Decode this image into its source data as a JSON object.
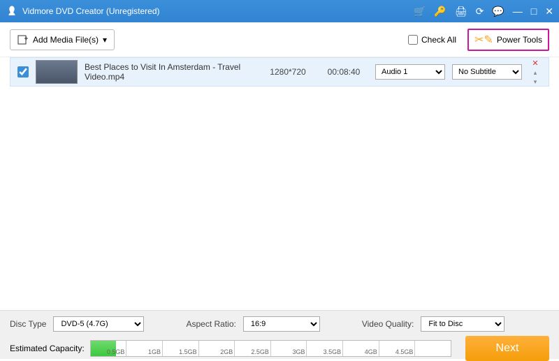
{
  "titlebar": {
    "title": "Vidmore DVD Creator (Unregistered)"
  },
  "toolbar": {
    "add_media": "Add Media File(s)",
    "check_all": "Check All",
    "power_tools": "Power Tools"
  },
  "media": {
    "items": [
      {
        "checked": true,
        "filename": "Best Places to Visit In Amsterdam - Travel Video.mp4",
        "resolution": "1280*720",
        "duration": "00:08:40",
        "audio": "Audio 1",
        "subtitle": "No Subtitle"
      }
    ]
  },
  "bottom": {
    "disc_type_label": "Disc Type",
    "disc_type": "DVD-5 (4.7G)",
    "aspect_label": "Aspect Ratio:",
    "aspect": "16:9",
    "quality_label": "Video Quality:",
    "quality": "Fit to Disc",
    "capacity_label": "Estimated Capacity:",
    "ticks": [
      "0.5GB",
      "1GB",
      "1.5GB",
      "2GB",
      "2.5GB",
      "3GB",
      "3.5GB",
      "4GB",
      "4.5GB",
      ""
    ],
    "next": "Next"
  }
}
